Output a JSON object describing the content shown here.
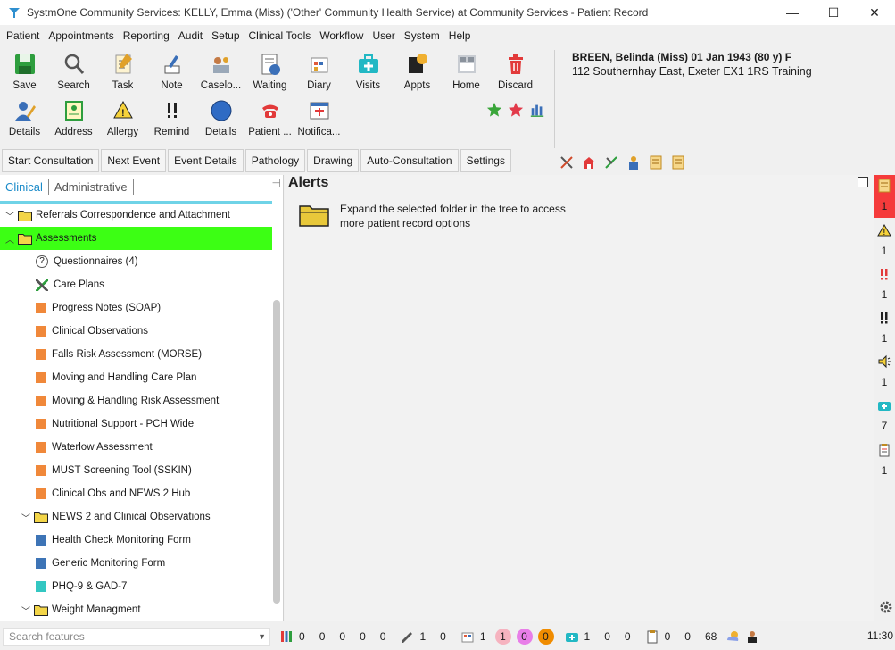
{
  "window": {
    "title": "SystmOne Community Services: KELLY, Emma (Miss) ('Other' Community Health Service) at Community Services - Patient Record",
    "controls": [
      "—",
      "☐",
      "✕"
    ]
  },
  "menu": [
    "Patient",
    "Appointments",
    "Reporting",
    "Audit",
    "Setup",
    "Clinical Tools",
    "Workflow",
    "User",
    "System",
    "Help"
  ],
  "toolbar": {
    "row1": [
      {
        "label": "Save",
        "icon": "save-icon"
      },
      {
        "label": "Search",
        "icon": "search-icon"
      },
      {
        "label": "Task",
        "icon": "task-icon"
      },
      {
        "label": "Note",
        "icon": "note-icon"
      },
      {
        "label": "Caselo...",
        "icon": "caseload-icon"
      },
      {
        "label": "Waiting",
        "icon": "waiting-icon"
      },
      {
        "label": "Diary",
        "icon": "diary-icon"
      },
      {
        "label": "Visits",
        "icon": "visits-icon"
      },
      {
        "label": "Appts",
        "icon": "appts-icon"
      },
      {
        "label": "Home",
        "icon": "home-icon"
      },
      {
        "label": "Discard",
        "icon": "discard-icon"
      }
    ],
    "row2": [
      {
        "label": "Details",
        "icon": "details-icon"
      },
      {
        "label": "Address",
        "icon": "address-icon"
      },
      {
        "label": "Allergy",
        "icon": "allergy-icon"
      },
      {
        "label": "Remind",
        "icon": "remind-icon"
      },
      {
        "label": "Details",
        "icon": "circle-details-icon"
      },
      {
        "label": "Patient ...",
        "icon": "phone-icon"
      },
      {
        "label": "Notifica...",
        "icon": "notification-icon"
      }
    ]
  },
  "patient": {
    "name": "BREEN, Belinda (Miss) 01 Jan 1943 (80 y) F",
    "address": "112 Southernhay East, Exeter EX1 1RS  Training"
  },
  "actions": [
    "Start Consultation",
    "Next Event",
    "Event Details",
    "Pathology",
    "Drawing",
    "Auto-Consultation",
    "Settings"
  ],
  "tabs": [
    "Clinical",
    "Administrative"
  ],
  "tree": [
    {
      "label": "Referrals Correspondence and Attachment",
      "type": "folder",
      "level": 0,
      "expanded": true,
      "selected": false
    },
    {
      "label": "Assessments",
      "type": "folder",
      "level": 0,
      "expanded": true,
      "selected": true
    },
    {
      "label": "Questionnaires (4)",
      "type": "question",
      "level": 1
    },
    {
      "label": "Care Plans",
      "type": "careplan",
      "level": 1
    },
    {
      "label": "Progress Notes (SOAP)",
      "type": "orange",
      "level": 1
    },
    {
      "label": "Clinical Observations",
      "type": "orange",
      "level": 1
    },
    {
      "label": "Falls Risk Assessment (MORSE)",
      "type": "orange",
      "level": 1
    },
    {
      "label": "Moving and Handling Care Plan",
      "type": "orange",
      "level": 1
    },
    {
      "label": "Moving & Handling Risk Assessment",
      "type": "orange",
      "level": 1
    },
    {
      "label": "Nutritional Support - PCH Wide",
      "type": "orange",
      "level": 1
    },
    {
      "label": "Waterlow Assessment",
      "type": "orange",
      "level": 1
    },
    {
      "label": "MUST Screening Tool (SSKIN)",
      "type": "orange",
      "level": 1
    },
    {
      "label": "Clinical Obs and NEWS 2 Hub",
      "type": "orange",
      "level": 1
    },
    {
      "label": "NEWS 2 and Clinical Observations",
      "type": "folder",
      "level": 1,
      "expanded": true
    },
    {
      "label": "Health Check Monitoring Form",
      "type": "blue",
      "level": 1
    },
    {
      "label": "Generic Monitoring Form",
      "type": "blue",
      "level": 1
    },
    {
      "label": "PHQ-9 & GAD-7",
      "type": "teal",
      "level": 1
    },
    {
      "label": "Weight Managment",
      "type": "folder",
      "level": 1,
      "expanded": true
    }
  ],
  "alerts": {
    "title": "Alerts",
    "message": "Expand the selected folder in the tree to access more patient record options"
  },
  "right_strip": [
    {
      "icon": "notes-alert-icon",
      "count": "1",
      "red": true
    },
    {
      "icon": "allergy-warning-icon",
      "count": "1"
    },
    {
      "icon": "red-exclaim-icon",
      "count": "1"
    },
    {
      "icon": "black-exclaim-icon",
      "count": "1"
    },
    {
      "icon": "speaker-icon",
      "count": "1"
    },
    {
      "icon": "medkit-icon",
      "count": "7"
    },
    {
      "icon": "clipboard-icon",
      "count": "1"
    }
  ],
  "statusbar": {
    "search_placeholder": "Search features",
    "g1": [
      "0",
      "0",
      "0",
      "0",
      "0"
    ],
    "g2": [
      "1",
      "0"
    ],
    "g3": [
      "1"
    ],
    "pills": [
      {
        "value": "1",
        "color": "#f6b3bf"
      },
      {
        "value": "0",
        "color": "#e87ee8"
      },
      {
        "value": "0",
        "color": "#f08c00"
      }
    ],
    "g4": [
      "1",
      "0",
      "0"
    ],
    "g5": [
      "0",
      "0",
      "68"
    ],
    "time": "11:30"
  },
  "colors": {
    "selected_row": "#3cff14",
    "tab_active": "#1b8bc9",
    "tab_underline": "#6fd3e7",
    "orange_item": "#f0883a",
    "blue_item": "#3d74b6",
    "teal_item": "#33c7c2"
  }
}
